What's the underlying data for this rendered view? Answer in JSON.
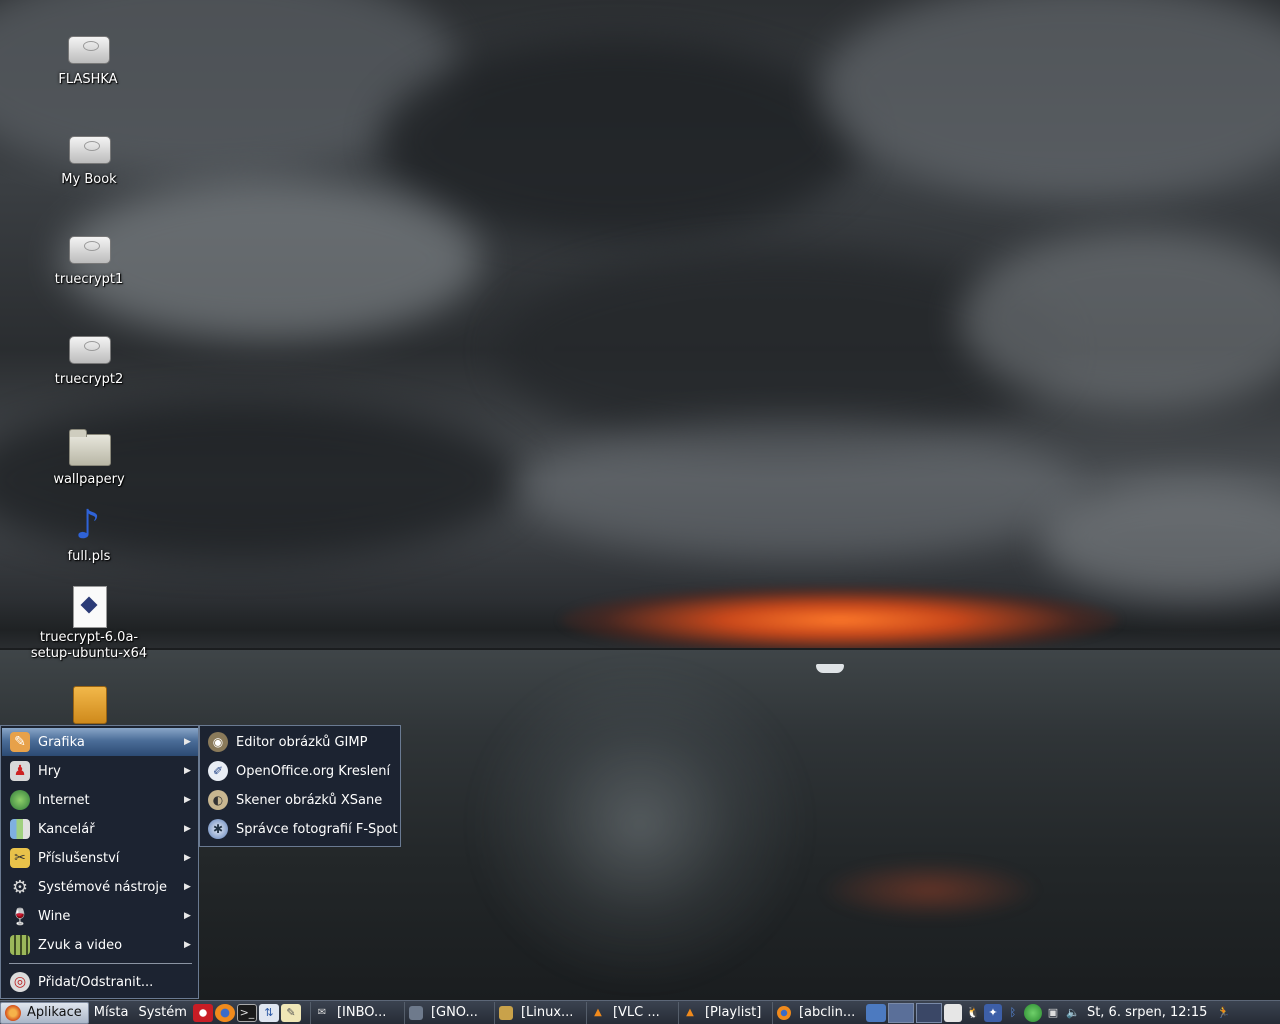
{
  "desktop": {
    "icons": [
      {
        "label": "FLASHKA",
        "icon": "drive-icon"
      },
      {
        "label": "My Book",
        "icon": "drive-icon"
      },
      {
        "label": "truecrypt1",
        "icon": "drive-icon"
      },
      {
        "label": "truecrypt2",
        "icon": "drive-icon"
      },
      {
        "label": "wallpapery",
        "icon": "folder-icon"
      },
      {
        "label": "full.pls",
        "icon": "music-note-icon"
      },
      {
        "label": "truecrypt-6.0a-setup-ubuntu-x64",
        "label_line1": "truecrypt-6.0a-",
        "label_line2": "setup-ubuntu-x64",
        "icon": "script-file-icon"
      },
      {
        "label": "",
        "icon": "package-icon"
      }
    ]
  },
  "menu": {
    "items": [
      {
        "label": "Grafika",
        "icon": "graphics-icon",
        "active": true
      },
      {
        "label": "Hry",
        "icon": "games-icon"
      },
      {
        "label": "Internet",
        "icon": "internet-globe-icon"
      },
      {
        "label": "Kancelář",
        "icon": "office-icon"
      },
      {
        "label": "Příslušenství",
        "icon": "accessories-icon"
      },
      {
        "label": "Systémové nástroje",
        "icon": "system-tools-icon"
      },
      {
        "label": "Wine",
        "icon": "wine-glass-icon"
      },
      {
        "label": "Zvuk a video",
        "icon": "sound-video-icon"
      }
    ],
    "add_remove": {
      "label": "Přidat/Odstranit...",
      "icon": "add-remove-icon"
    }
  },
  "submenu": {
    "items": [
      {
        "label": "Editor obrázků GIMP",
        "icon": "gimp-icon"
      },
      {
        "label": "OpenOffice.org Kreslení",
        "icon": "openoffice-draw-icon"
      },
      {
        "label": "Skener obrázků XSane",
        "icon": "xsane-scanner-icon"
      },
      {
        "label": "Správce fotografií F-Spot",
        "icon": "f-spot-icon"
      }
    ]
  },
  "panel": {
    "menus": {
      "applications": "Aplikace",
      "places": "Místa",
      "system": "Systém"
    },
    "launchers": [
      "opera-icon",
      "firefox-icon",
      "terminal-icon",
      "network-icon",
      "notes-icon"
    ],
    "tasks": [
      {
        "label": "[INBO...",
        "icon": "mail-icon"
      },
      {
        "label": "[GNO...",
        "icon": "gnome-terminal-icon"
      },
      {
        "label": "[Linux...",
        "icon": "linux-app-icon"
      },
      {
        "label": "[VLC ...",
        "icon": "vlc-icon"
      },
      {
        "label": "[Playlist]",
        "icon": "vlc-icon"
      },
      {
        "label": "[abclin...",
        "icon": "firefox-icon"
      }
    ],
    "clock": "St,  6. srpen, 12:15"
  },
  "colors": {
    "menu_bg": "#1c2331",
    "menu_active": "#4b6d98",
    "panel_bg": "#2d3440"
  }
}
